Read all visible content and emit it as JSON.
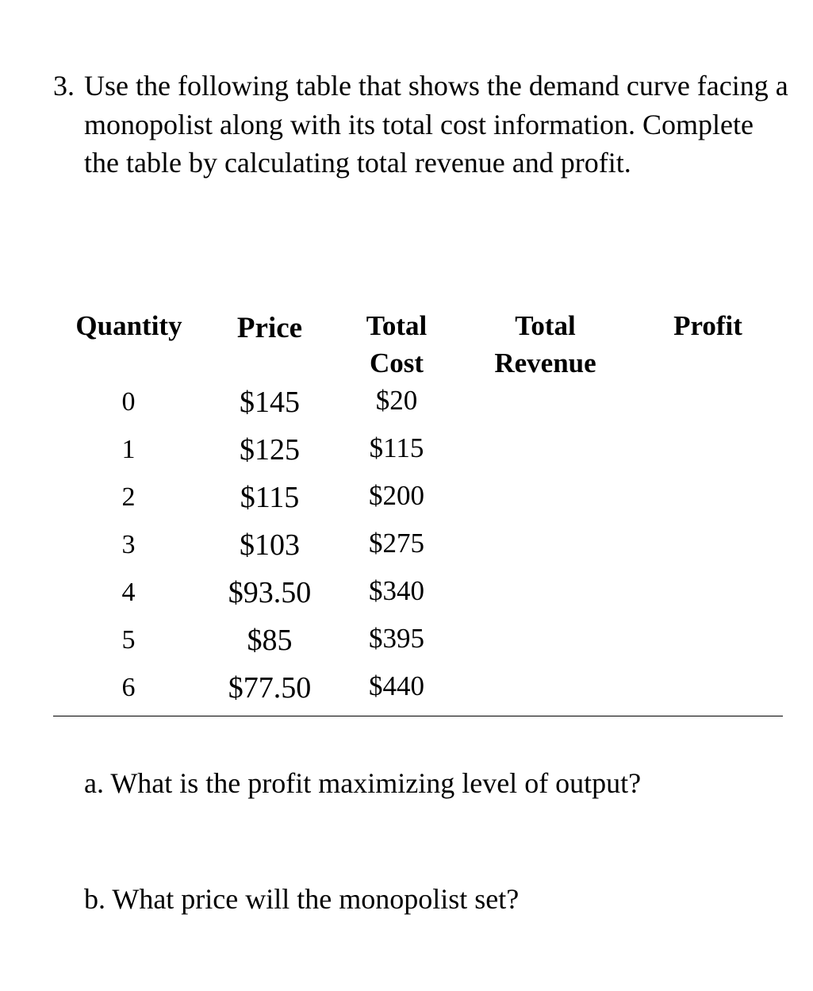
{
  "question": {
    "number": "3.",
    "text": "Use the following table that shows the demand curve facing a monopolist along with its total cost information. Complete the table by calculating total revenue and profit."
  },
  "table": {
    "headers": {
      "quantity": "Quantity",
      "price": "Price",
      "total_cost_line1": "Total",
      "total_cost_line2": "Cost",
      "total_revenue_line1": "Total",
      "total_revenue_line2": "Revenue",
      "profit": "Profit"
    },
    "rows": [
      {
        "quantity": "0",
        "price": "$145",
        "total_cost": "$20",
        "total_revenue": "",
        "profit": ""
      },
      {
        "quantity": "1",
        "price": "$125",
        "total_cost": "$115",
        "total_revenue": "",
        "profit": ""
      },
      {
        "quantity": "2",
        "price": "$115",
        "total_cost": "$200",
        "total_revenue": "",
        "profit": ""
      },
      {
        "quantity": "3",
        "price": "$103",
        "total_cost": "$275",
        "total_revenue": "",
        "profit": ""
      },
      {
        "quantity": "4",
        "price": "$93.50",
        "total_cost": "$340",
        "total_revenue": "",
        "profit": ""
      },
      {
        "quantity": "5",
        "price": "$85",
        "total_cost": "$395",
        "total_revenue": "",
        "profit": ""
      },
      {
        "quantity": "6",
        "price": "$77.50",
        "total_cost": "$440",
        "total_revenue": "",
        "profit": ""
      }
    ]
  },
  "sub_questions": {
    "a": "a. What is the profit maximizing level of output?",
    "b": "b. What price will the monopolist set?"
  }
}
